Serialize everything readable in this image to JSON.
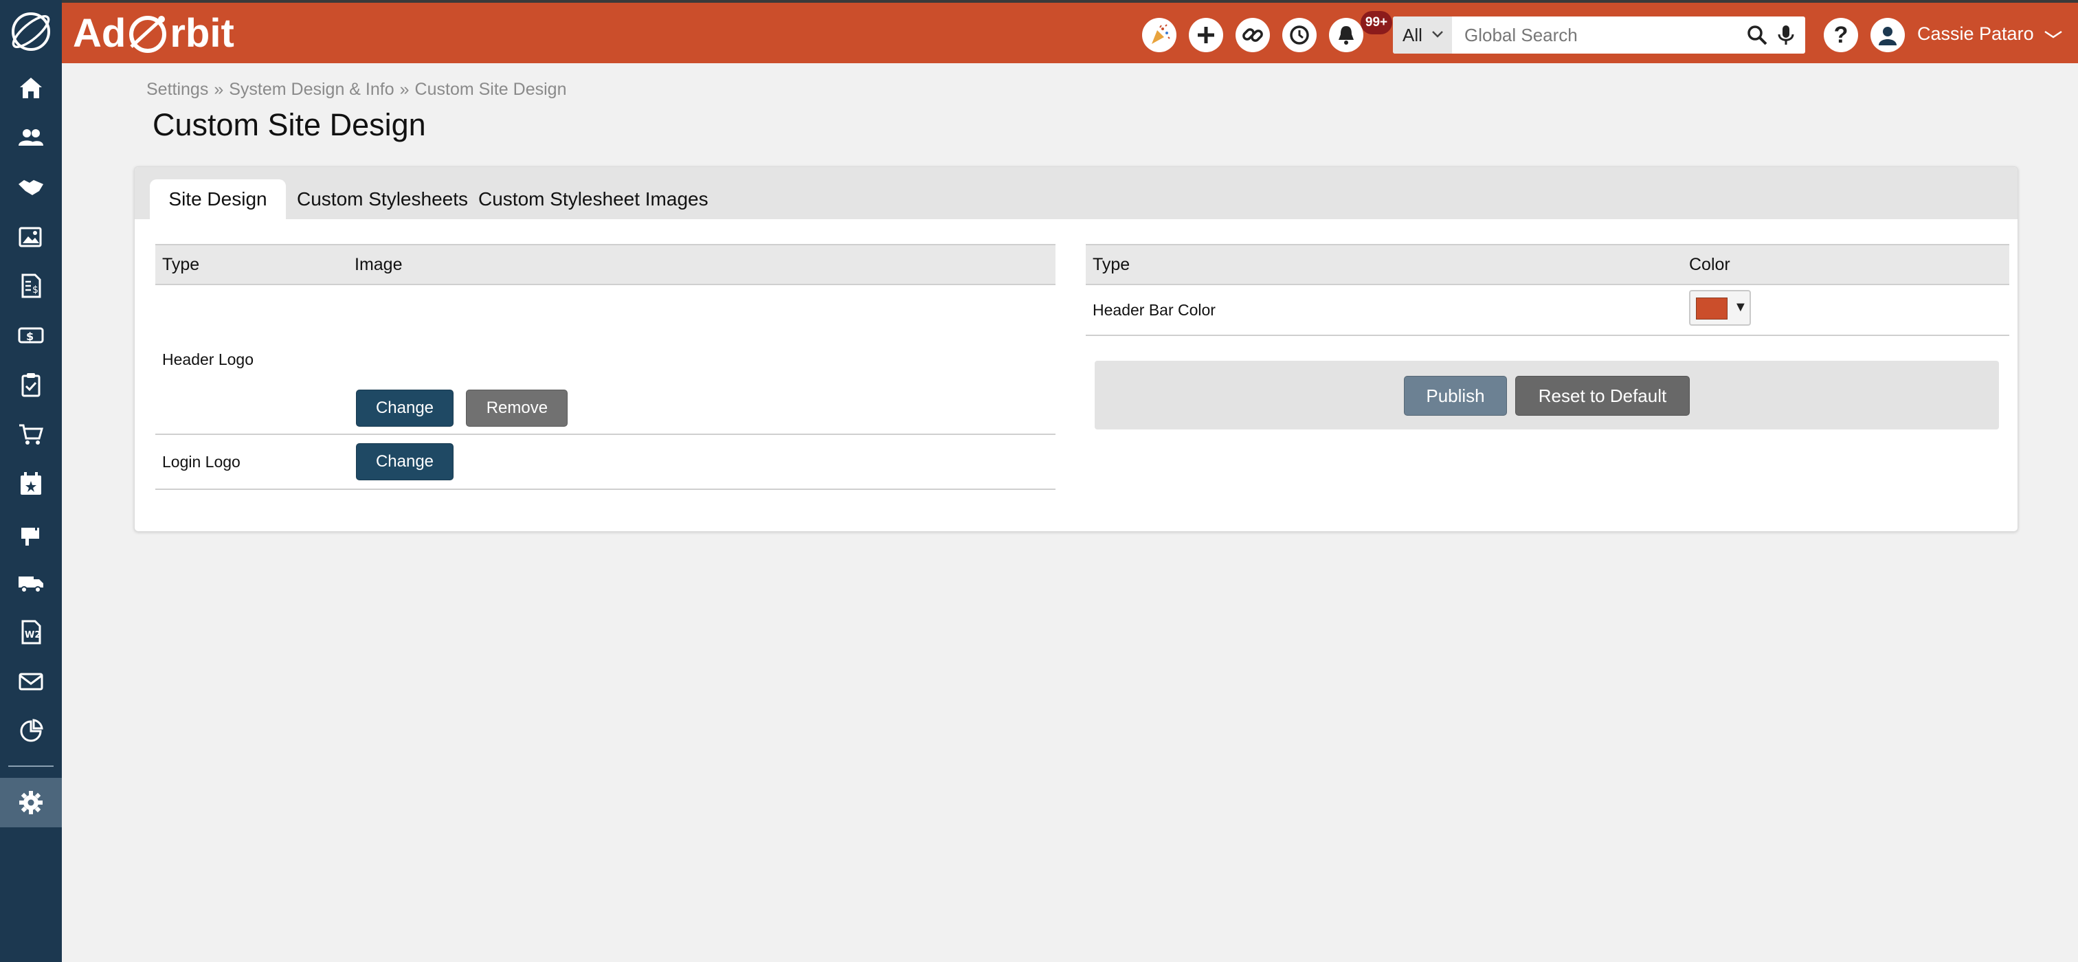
{
  "app": {
    "brand": "AdOrbit",
    "brand_left": "Ad",
    "brand_right": "rbit",
    "header_color": "#cb4e2b",
    "sidebar_color": "#1c3850"
  },
  "sidebar": {
    "items": [
      {
        "name": "home-icon"
      },
      {
        "name": "contacts-icon"
      },
      {
        "name": "handshake-icon"
      },
      {
        "name": "media-icon"
      },
      {
        "name": "invoice-icon"
      },
      {
        "name": "money-icon"
      },
      {
        "name": "clipboard-icon"
      },
      {
        "name": "cart-icon"
      },
      {
        "name": "calendar-star-icon"
      },
      {
        "name": "mailbox-icon"
      },
      {
        "name": "truck-icon"
      },
      {
        "name": "w2-icon"
      },
      {
        "name": "envelope-icon"
      },
      {
        "name": "chart-icon"
      },
      {
        "name": "gear-icon"
      }
    ]
  },
  "header": {
    "notification_count": "99+",
    "search_scope": "All",
    "search_placeholder": "Global Search",
    "help_label": "?",
    "user_name": "Cassie Pataro"
  },
  "breadcrumb": {
    "items": [
      "Settings",
      "System Design & Info",
      "Custom Site Design"
    ],
    "separator": "»"
  },
  "page": {
    "title": "Custom Site Design"
  },
  "tabs": [
    {
      "label": "Site Design",
      "active": true
    },
    {
      "label": "Custom Stylesheets",
      "active": false
    },
    {
      "label": "Custom Stylesheet Images",
      "active": false
    }
  ],
  "images_table": {
    "columns": [
      "Type",
      "Image"
    ],
    "rows": [
      {
        "type": "Header Logo",
        "buttons": [
          "Change",
          "Remove"
        ]
      },
      {
        "type": "Login Logo",
        "buttons": [
          "Change"
        ]
      }
    ]
  },
  "colors_table": {
    "columns": [
      "Type",
      "Color"
    ],
    "rows": [
      {
        "type": "Header Bar Color",
        "color": "#cb4e2b",
        "arrow": "▼"
      }
    ]
  },
  "actions": {
    "publish": "Publish",
    "reset": "Reset to Default"
  }
}
